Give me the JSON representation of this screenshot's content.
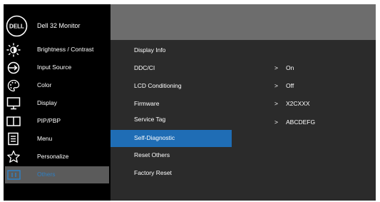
{
  "brand": {
    "title": "Dell 32 Monitor",
    "logo_text": "DELL"
  },
  "sidebar": {
    "items": [
      {
        "label": "Brightness / Contrast",
        "icon": "brightness-icon"
      },
      {
        "label": "Input Source",
        "icon": "input-source-icon"
      },
      {
        "label": "Color",
        "icon": "color-palette-icon"
      },
      {
        "label": "Display",
        "icon": "display-icon"
      },
      {
        "label": "PIP/PBP",
        "icon": "pip-pbp-icon"
      },
      {
        "label": "Menu",
        "icon": "menu-icon"
      },
      {
        "label": "Personalize",
        "icon": "star-icon"
      },
      {
        "label": "Others",
        "icon": "others-icon",
        "selected": true
      }
    ]
  },
  "submenu": {
    "items": [
      {
        "label": "Display Info"
      },
      {
        "label": "DDC/CI",
        "value": "On"
      },
      {
        "label": "LCD Conditioning",
        "value": "Off"
      },
      {
        "label": "Firmware",
        "value": "X2CXXX"
      },
      {
        "label": "Service Tag",
        "value": "ABCDEFG"
      },
      {
        "label": "Self-Diagnostic",
        "highlighted": true
      },
      {
        "label": "Reset Others"
      },
      {
        "label": "Factory Reset"
      }
    ],
    "chevron": ">"
  },
  "colors": {
    "highlight": "#1f6db5",
    "selected_text": "#2f7fc2",
    "sidebar_bg": "#000000",
    "panel_bg": "#2b2b2b",
    "topbar_bg": "#6d6d6d"
  }
}
